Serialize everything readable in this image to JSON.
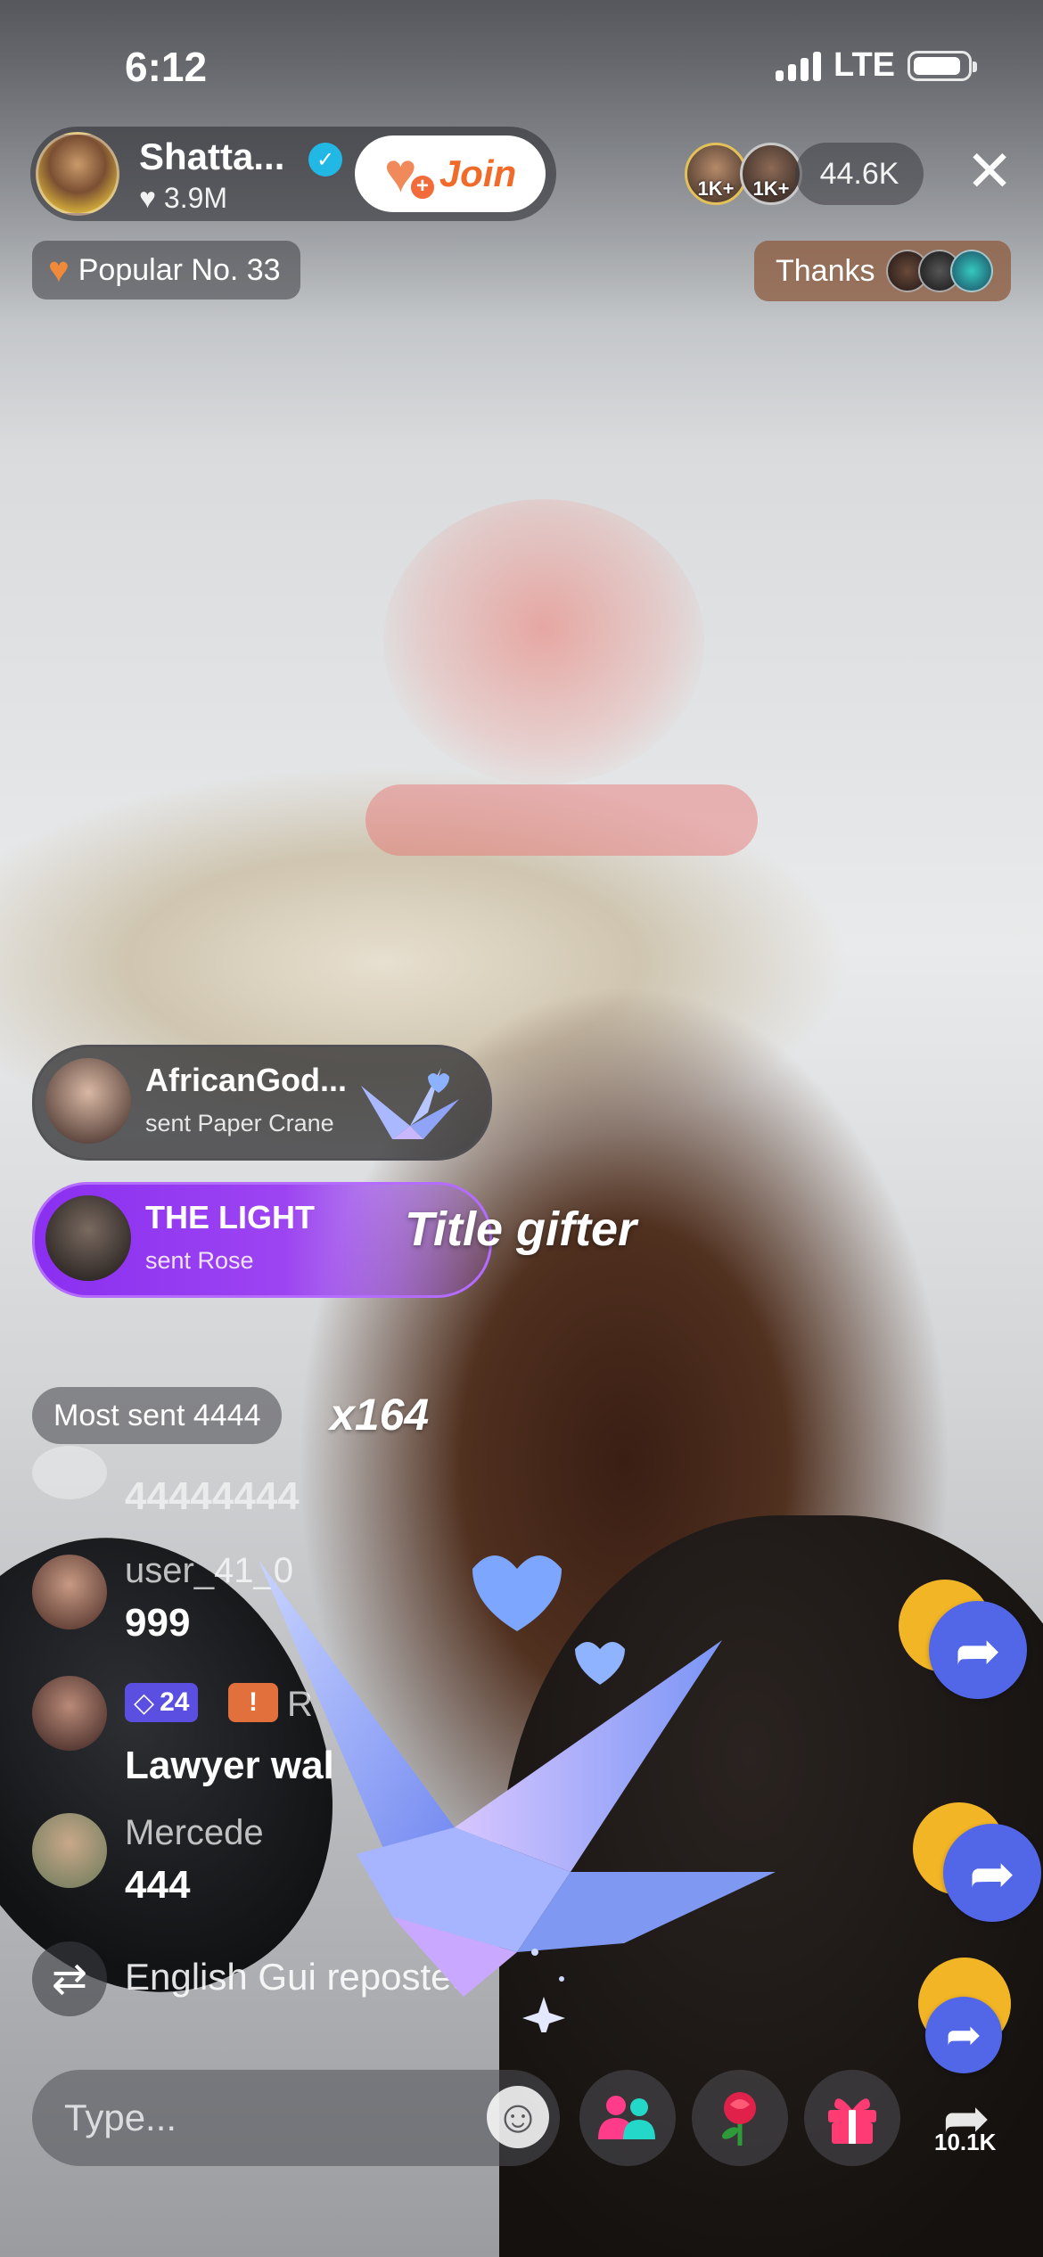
{
  "status_bar": {
    "time": "6:12",
    "network": "LTE"
  },
  "host": {
    "name": "Shatta...",
    "likes": "3.9M",
    "join_label": "Join"
  },
  "viewers": {
    "badge_1": "1K+",
    "badge_2": "1K+",
    "count": "44.6K"
  },
  "popular": {
    "label": "Popular No. 33"
  },
  "thanks": {
    "label": "Thanks"
  },
  "gifts": [
    {
      "user": "AfricanGod...",
      "action": "sent Paper Crane"
    },
    {
      "user": "THE LIGHT",
      "action": "sent Rose"
    }
  ],
  "title_gifter": "Title gifter",
  "most_sent": {
    "label": "Most sent 4444",
    "combo": "x164"
  },
  "chat": [
    {
      "name": "",
      "message": "44444444"
    },
    {
      "name": "user_41_0",
      "message": "999"
    },
    {
      "name": "R",
      "level": "24",
      "message": "Lawyer wal"
    },
    {
      "name": "Mercede",
      "message": "444"
    }
  ],
  "repost": {
    "text": "English Gui reposted"
  },
  "input": {
    "placeholder": "Type..."
  },
  "share": {
    "count": "10.1K"
  },
  "colors": {
    "join_orange": "#f06a2a",
    "gift_purple": "#8a2ff0",
    "share_blue": "#5267e8",
    "share_gold": "#f2b526",
    "level_badge": "#5a4fe0"
  },
  "icons": [
    "verified-icon",
    "heart-icon",
    "close-icon",
    "emoji-icon",
    "friends-icon",
    "rose-icon",
    "gift-icon",
    "share-icon",
    "repost-icon"
  ]
}
